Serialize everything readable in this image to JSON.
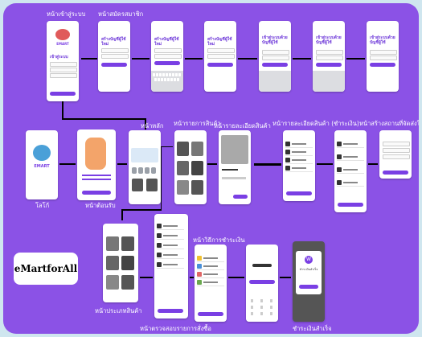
{
  "screens": {
    "login": "หน้าเข้าสู่ระบบ",
    "register": "หน้าสมัครสมาชิก",
    "main": "หน้าหลัก",
    "product_list": "หน้ารายการสินค้า",
    "product_detail": "หน้ารายละเอียดสินค้า",
    "cart_detail": "หน้ารายละเอียดสินค้า (ชำระเงิน)",
    "order_status": "หน้าสร้างสถานที่จัดส่งใหม่",
    "splash": "โลโก้",
    "welcome": "หน้าต้อนรับ",
    "category": "หน้าประเภทสินค้า",
    "checkout_summary": "หน้าตรวจสอบรายการสั่งซื้อ",
    "payment_method": "หน้าวิธีการชำระเงิน",
    "payment_success": "ชำระเงินสำเร็จ"
  },
  "phone_text": {
    "login_title": "เข้าสู่ระบบ",
    "register_title": "สร้างบัญชีผู้ใช้ใหม่",
    "login_alt_title": "เข้าสู่ระบบด้วยบัญชีผู้ใช้",
    "logo_text": "EMART",
    "success_title": "ชำระเงินสำเร็จ"
  },
  "brand": "eMartforAll",
  "colors": {
    "background": "#8b52e6",
    "accent": "#7a3fe4",
    "outer": "#cfe6ef"
  }
}
